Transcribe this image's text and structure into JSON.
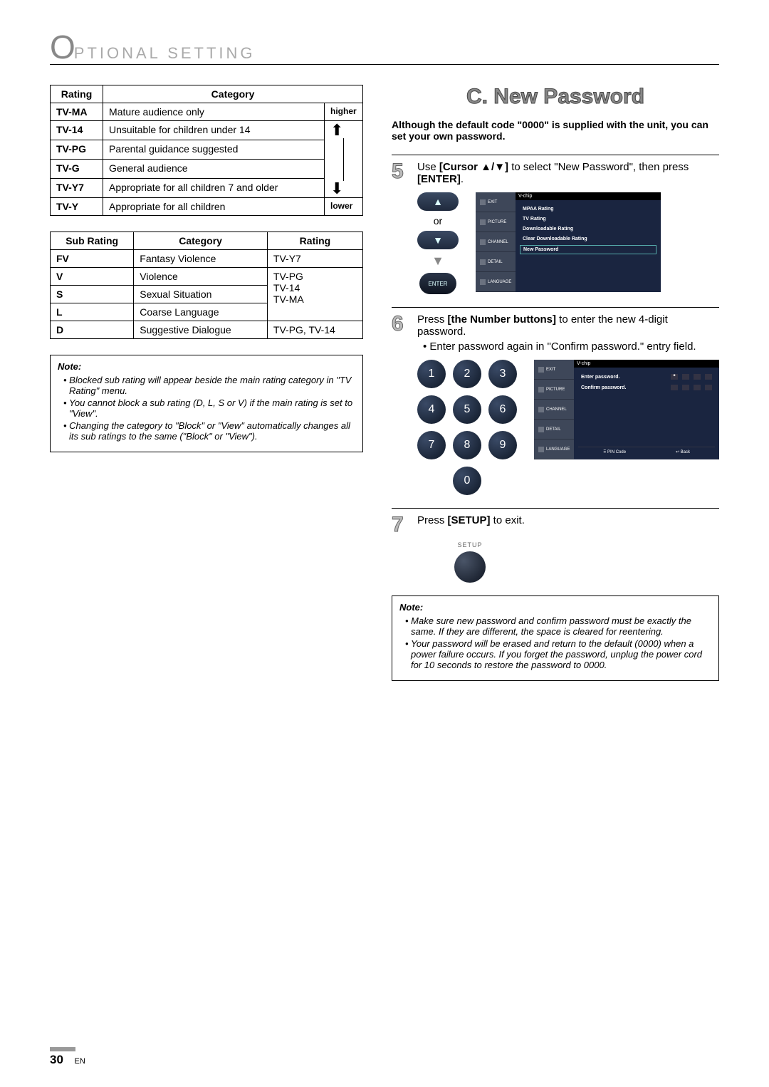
{
  "header": {
    "big_letter": "O",
    "rest": "PTIONAL  SETTING"
  },
  "rating_table": {
    "headers": [
      "Rating",
      "Category"
    ],
    "higher_label": "higher",
    "lower_label": "lower",
    "rows": [
      {
        "rating": "TV-MA",
        "category": "Mature audience only"
      },
      {
        "rating": "TV-14",
        "category": "Unsuitable for children under 14"
      },
      {
        "rating": "TV-PG",
        "category": "Parental guidance suggested"
      },
      {
        "rating": "TV-G",
        "category": "General audience"
      },
      {
        "rating": "TV-Y7",
        "category": "Appropriate for all children 7 and older"
      },
      {
        "rating": "TV-Y",
        "category": "Appropriate for all children"
      }
    ]
  },
  "sub_rating_table": {
    "headers": [
      "Sub Rating",
      "Category",
      "Rating"
    ],
    "rows": [
      {
        "sub": "FV",
        "category": "Fantasy Violence",
        "rating": "TV-Y7"
      },
      {
        "sub": "V",
        "category": "Violence",
        "rating_group_start": true
      },
      {
        "sub": "S",
        "category": "Sexual Situation"
      },
      {
        "sub": "L",
        "category": "Coarse Language"
      },
      {
        "sub": "D",
        "category": "Suggestive Dialogue",
        "rating": "TV-PG, TV-14"
      }
    ],
    "grouped_rating_lines": [
      "TV-PG",
      "TV-14",
      "TV-MA"
    ]
  },
  "note1": {
    "title": "Note:",
    "items": [
      "Blocked sub rating will appear beside the main rating category in \"TV Rating\" menu.",
      "You cannot block a sub rating (D, L, S or V) if the main rating is set to \"View\".",
      "Changing the category to \"Block\" or \"View\" automatically changes all its sub ratings to the same (\"Block\" or \"View\")."
    ]
  },
  "section_c": {
    "title": "C.  New Password",
    "intro": "Although the default code \"0000\" is supplied with the unit, you can set your own password."
  },
  "step5": {
    "num": "5",
    "text_pre": "Use ",
    "cursor_label": "[Cursor ▲/▼]",
    "text_mid": " to select \"New Password\", then press ",
    "enter_label": "[ENTER]",
    "text_post": "."
  },
  "step6": {
    "num": "6",
    "text_pre": "Press ",
    "numbtn_label": "[the Number buttons]",
    "text_post": " to enter the new 4-digit password.",
    "bullet": "Enter password again in \"Confirm password.\" entry field."
  },
  "step7": {
    "num": "7",
    "text_pre": "Press ",
    "setup_label": "[SETUP]",
    "text_post": " to exit."
  },
  "remote": {
    "or_label": "or",
    "enter_label": "ENTER",
    "setup_label": "SETUP",
    "numbers": [
      "1",
      "2",
      "3",
      "4",
      "5",
      "6",
      "7",
      "8",
      "9",
      "0"
    ]
  },
  "osd1": {
    "panel_title": "V-chip",
    "side_items": [
      "EXIT",
      "PICTURE",
      "CHANNEL",
      "DETAIL",
      "LANGUAGE"
    ],
    "menu_items": [
      {
        "label": "MPAA Rating",
        "selected": false
      },
      {
        "label": "TV Rating",
        "selected": false
      },
      {
        "label": "Downloadable Rating",
        "selected": false
      },
      {
        "label": "Clear Downloadable Rating",
        "selected": false
      },
      {
        "label": "New Password",
        "selected": true
      }
    ]
  },
  "osd2": {
    "panel_title": "V-chip",
    "side_items": [
      "EXIT",
      "PICTURE",
      "CHANNEL",
      "DETAIL",
      "LANGUAGE"
    ],
    "enter_pw": "Enter password.",
    "confirm_pw": "Confirm password.",
    "footer_left": "PIN Code",
    "footer_right": "Back"
  },
  "note2": {
    "title": "Note:",
    "items": [
      "Make sure new password and confirm password must be exactly the same. If they are different, the space is cleared for reentering.",
      "Your password will be erased and return to the default (0000) when a power failure occurs. If you forget the password, unplug the power cord for 10 seconds to restore the password to 0000."
    ]
  },
  "page_footer": {
    "number": "30",
    "lang": "EN"
  }
}
